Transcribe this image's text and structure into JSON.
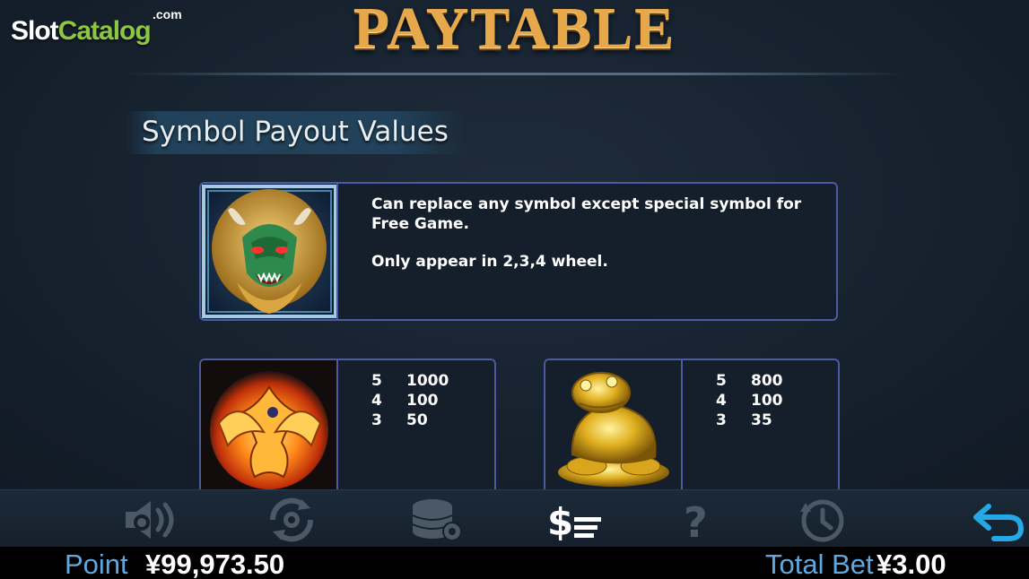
{
  "brand": {
    "logo_slot": "Slot",
    "logo_catalog": "Catalog",
    "logo_com": ".com"
  },
  "header": {
    "title": "PAYTABLE"
  },
  "section": {
    "title": "Symbol Payout Values"
  },
  "wild": {
    "symbol": "green-dragon-icon",
    "line1": "Can replace any symbol except special symbol for Free Game.",
    "line2": "Only appear in 2,3,4 wheel."
  },
  "symbols": [
    {
      "symbol": "phoenix-icon",
      "pays": [
        {
          "count": "5",
          "amount": "1000"
        },
        {
          "count": "4",
          "amount": "100"
        },
        {
          "count": "3",
          "amount": "50"
        }
      ]
    },
    {
      "symbol": "golden-toad-icon",
      "pays": [
        {
          "count": "5",
          "amount": "800"
        },
        {
          "count": "4",
          "amount": "100"
        },
        {
          "count": "3",
          "amount": "35"
        }
      ]
    }
  ],
  "toolbar": {
    "buttons": [
      "sound-icon",
      "autoplay-icon",
      "bet-chips-icon",
      "paytable-icon",
      "help-icon",
      "history-icon",
      "back-arrow-icon"
    ],
    "active_color": "#ffffff",
    "inactive_color": "#4b5866",
    "back_color": "#25a9e6"
  },
  "footer": {
    "point_label": "Point",
    "point_value": "¥99,973.50",
    "total_bet_label": "Total Bet",
    "total_bet_value": "¥3.00"
  }
}
